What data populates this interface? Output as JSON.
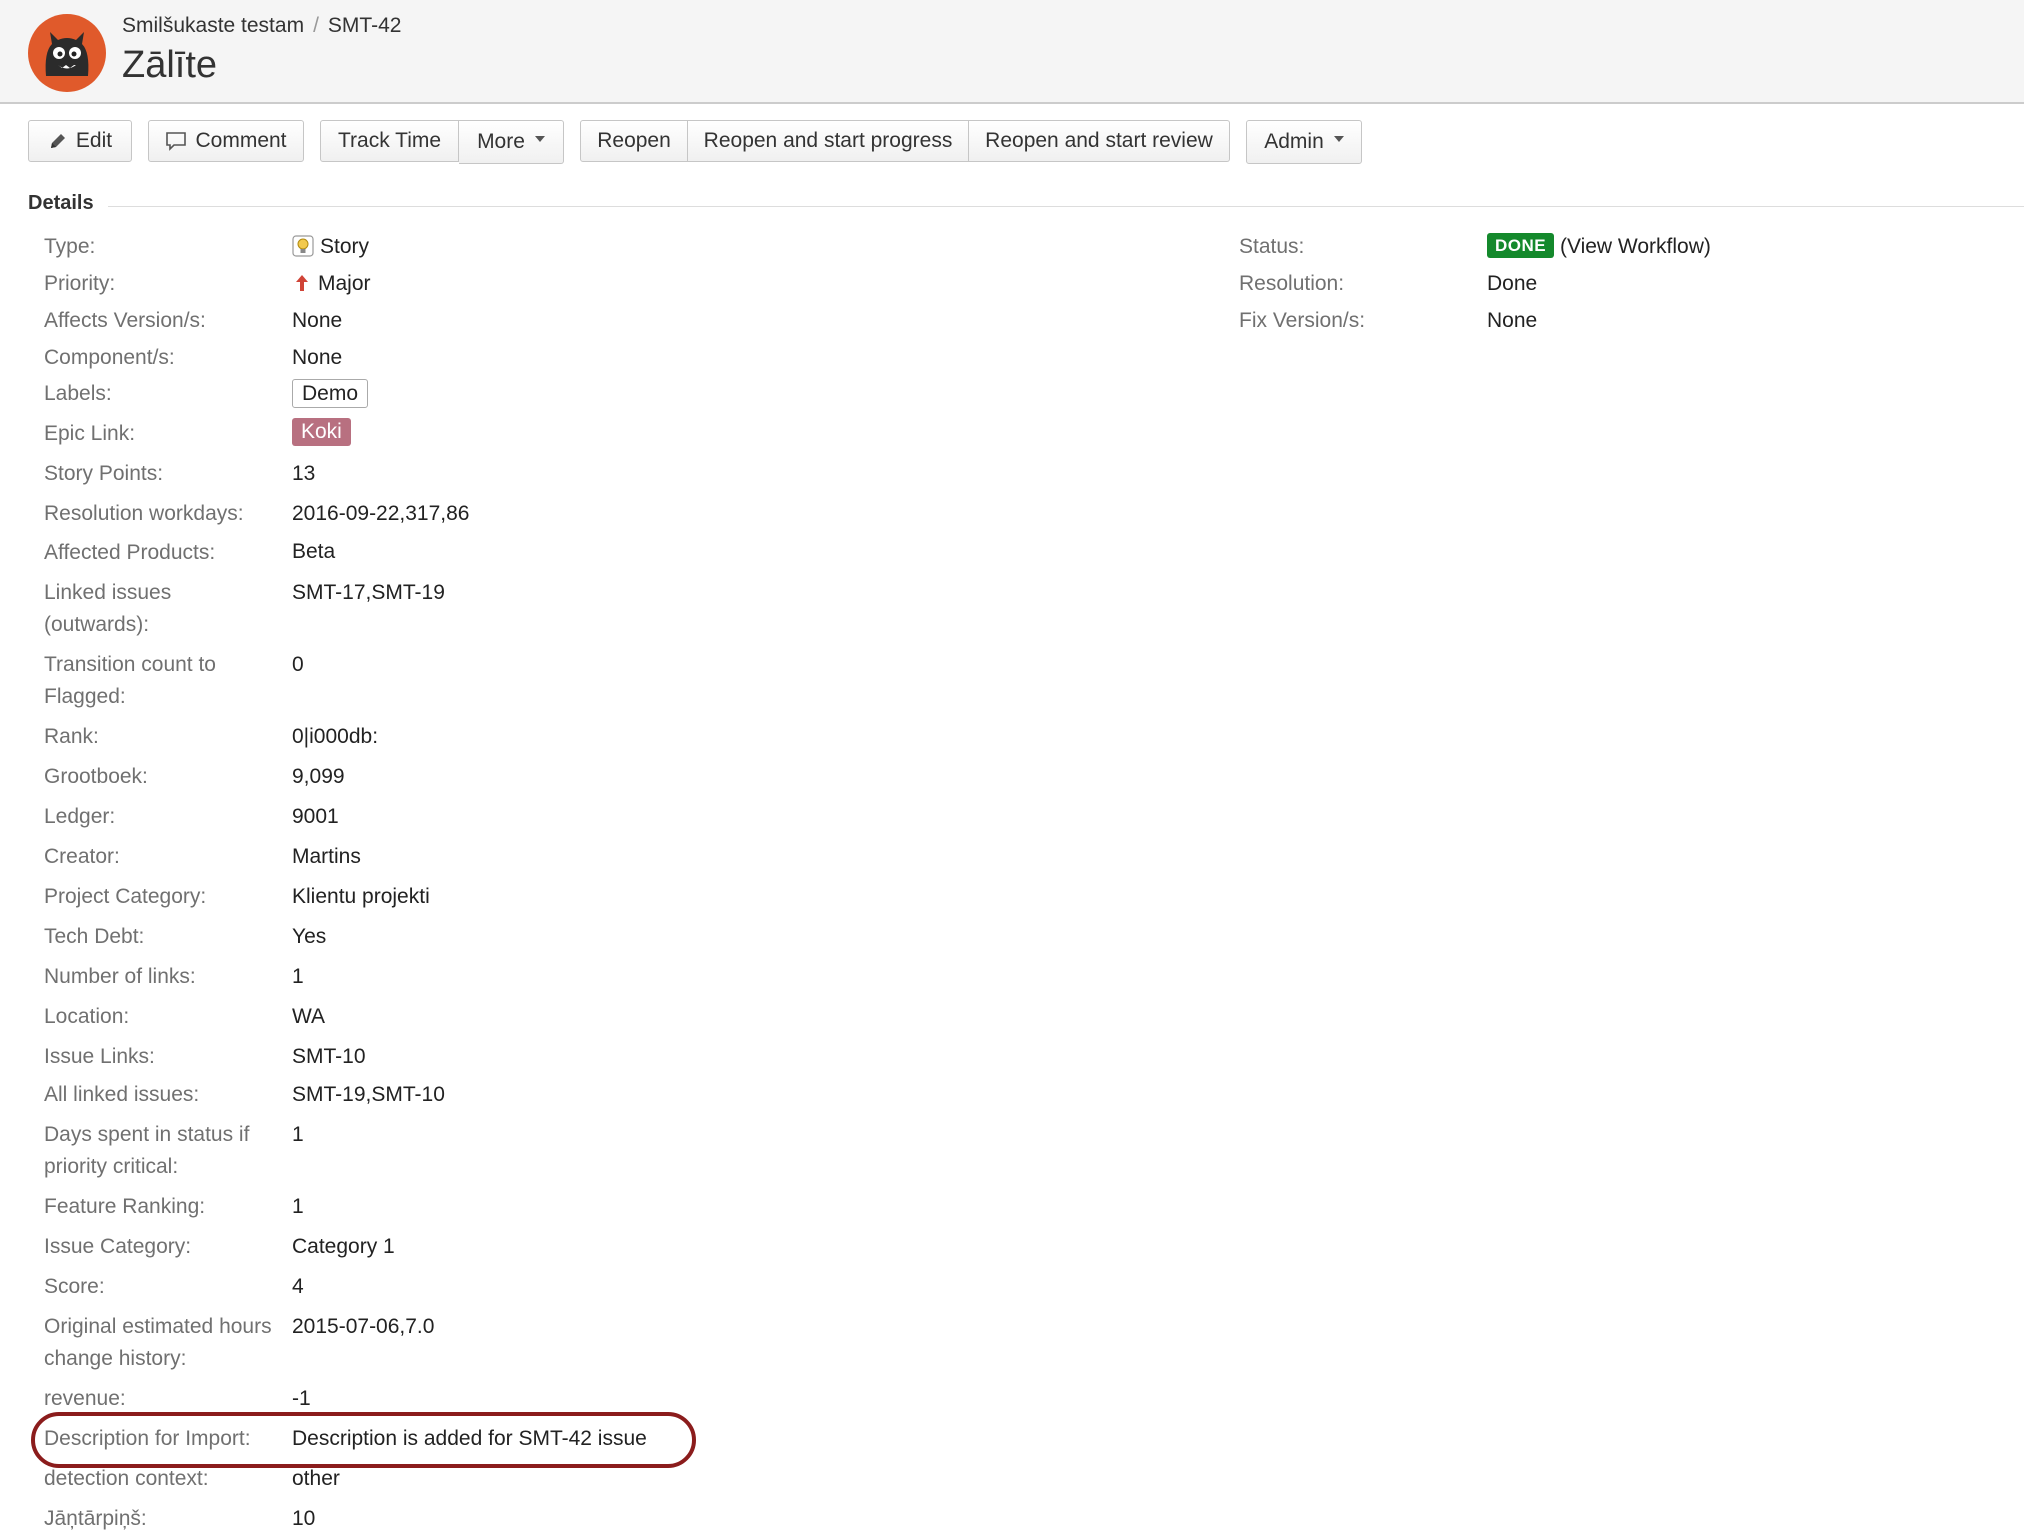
{
  "header": {
    "project": "Smilšukaste testam",
    "separator": "/",
    "issue_key": "SMT-42",
    "title": "Zālīte"
  },
  "toolbar": {
    "edit": "Edit",
    "comment": "Comment",
    "track_time": "Track Time",
    "more": "More",
    "reopen": "Reopen",
    "reopen_start_progress": "Reopen and start progress",
    "reopen_start_review": "Reopen and start review",
    "admin": "Admin"
  },
  "details": {
    "heading": "Details",
    "left": [
      {
        "label": "Type:",
        "value": "Story",
        "icon": "story-icon"
      },
      {
        "label": "Priority:",
        "value": "Major",
        "icon": "priority-major-icon"
      },
      {
        "label": "Affects Version/s:",
        "value": "None"
      },
      {
        "label": "Component/s:",
        "value": "None"
      },
      {
        "label": "Labels:",
        "value": "Demo"
      },
      {
        "label": "Epic Link:",
        "value": "Koki"
      },
      {
        "label": "Story Points:",
        "value": "13"
      },
      {
        "label": "Resolution workdays:",
        "value": "2016-09-22,317,86"
      },
      {
        "label": "Affected Products:",
        "value": "Beta"
      },
      {
        "label": "Linked issues (outwards):",
        "value": "SMT-17,SMT-19"
      },
      {
        "label": "Transition count to Flagged:",
        "value": "0"
      },
      {
        "label": "Rank:",
        "value": "0|i000db:"
      },
      {
        "label": "Grootboek:",
        "value": "9,099"
      },
      {
        "label": "Ledger:",
        "value": "9001"
      },
      {
        "label": "Creator:",
        "value": "Martins"
      },
      {
        "label": "Project Category:",
        "value": "Klientu projekti"
      },
      {
        "label": "Tech Debt:",
        "value": "Yes"
      },
      {
        "label": "Number of links:",
        "value": "1"
      },
      {
        "label": "Location:",
        "value": "WA"
      },
      {
        "label": "Issue Links:",
        "value": "SMT-10"
      },
      {
        "label": "All linked issues:",
        "value": "SMT-19,SMT-10"
      },
      {
        "label": "Days spent in status if priority critical:",
        "value": "1"
      },
      {
        "label": "Feature Ranking:",
        "value": "1"
      },
      {
        "label": "Issue Category:",
        "value": "Category 1"
      },
      {
        "label": "Score:",
        "value": "4"
      },
      {
        "label": "Original estimated hours change history:",
        "value": "2015-07-06,7.0"
      },
      {
        "label": "revenue:",
        "value": "-1"
      },
      {
        "label": "Description for Import:",
        "value": "Description is added for SMT-42 issue"
      },
      {
        "label": "detection context:",
        "value": "other"
      },
      {
        "label": "Jāņtārpiņš:",
        "value": "10"
      }
    ],
    "right": [
      {
        "label": "Status:",
        "value": "DONE",
        "link": "(View Workflow)"
      },
      {
        "label": "Resolution:",
        "value": "Done"
      },
      {
        "label": "Fix Version/s:",
        "value": "None"
      }
    ]
  },
  "colors": {
    "done_lozenge": "#14892c",
    "epic_tag": "#b87080",
    "highlight_ring": "#8b1c1c",
    "avatar": "#e05a2b"
  }
}
